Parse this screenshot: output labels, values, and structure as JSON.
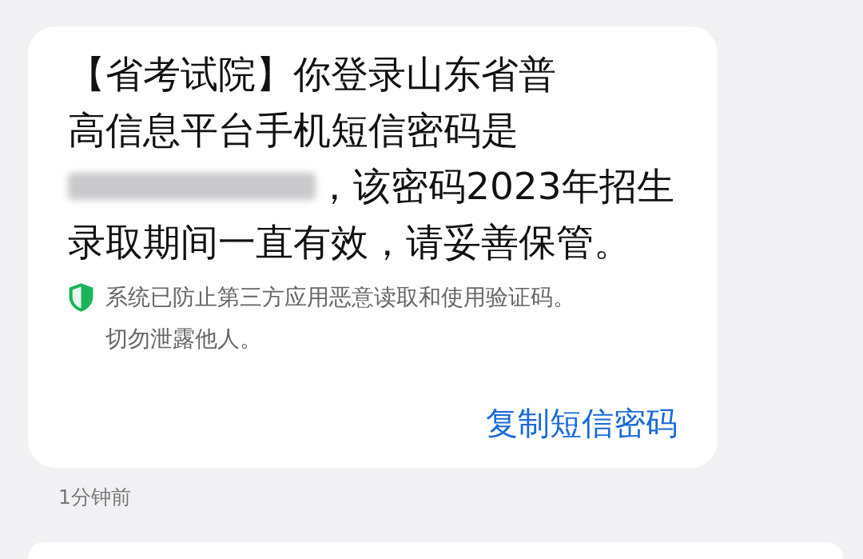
{
  "message": {
    "lines": [
      "【省考试院】你登录山东省普",
      "高信息平台手机短信密码是",
      "，该密码2023年招生",
      "录取期间一直有效，请妥善保管。"
    ],
    "password_redacted": true,
    "security_notice": [
      "系统已防止第三方应用恶意读取和使用验证码。",
      "切勿泄露他人。"
    ],
    "copy_button": "复制短信密码",
    "time": "1分钟前"
  }
}
